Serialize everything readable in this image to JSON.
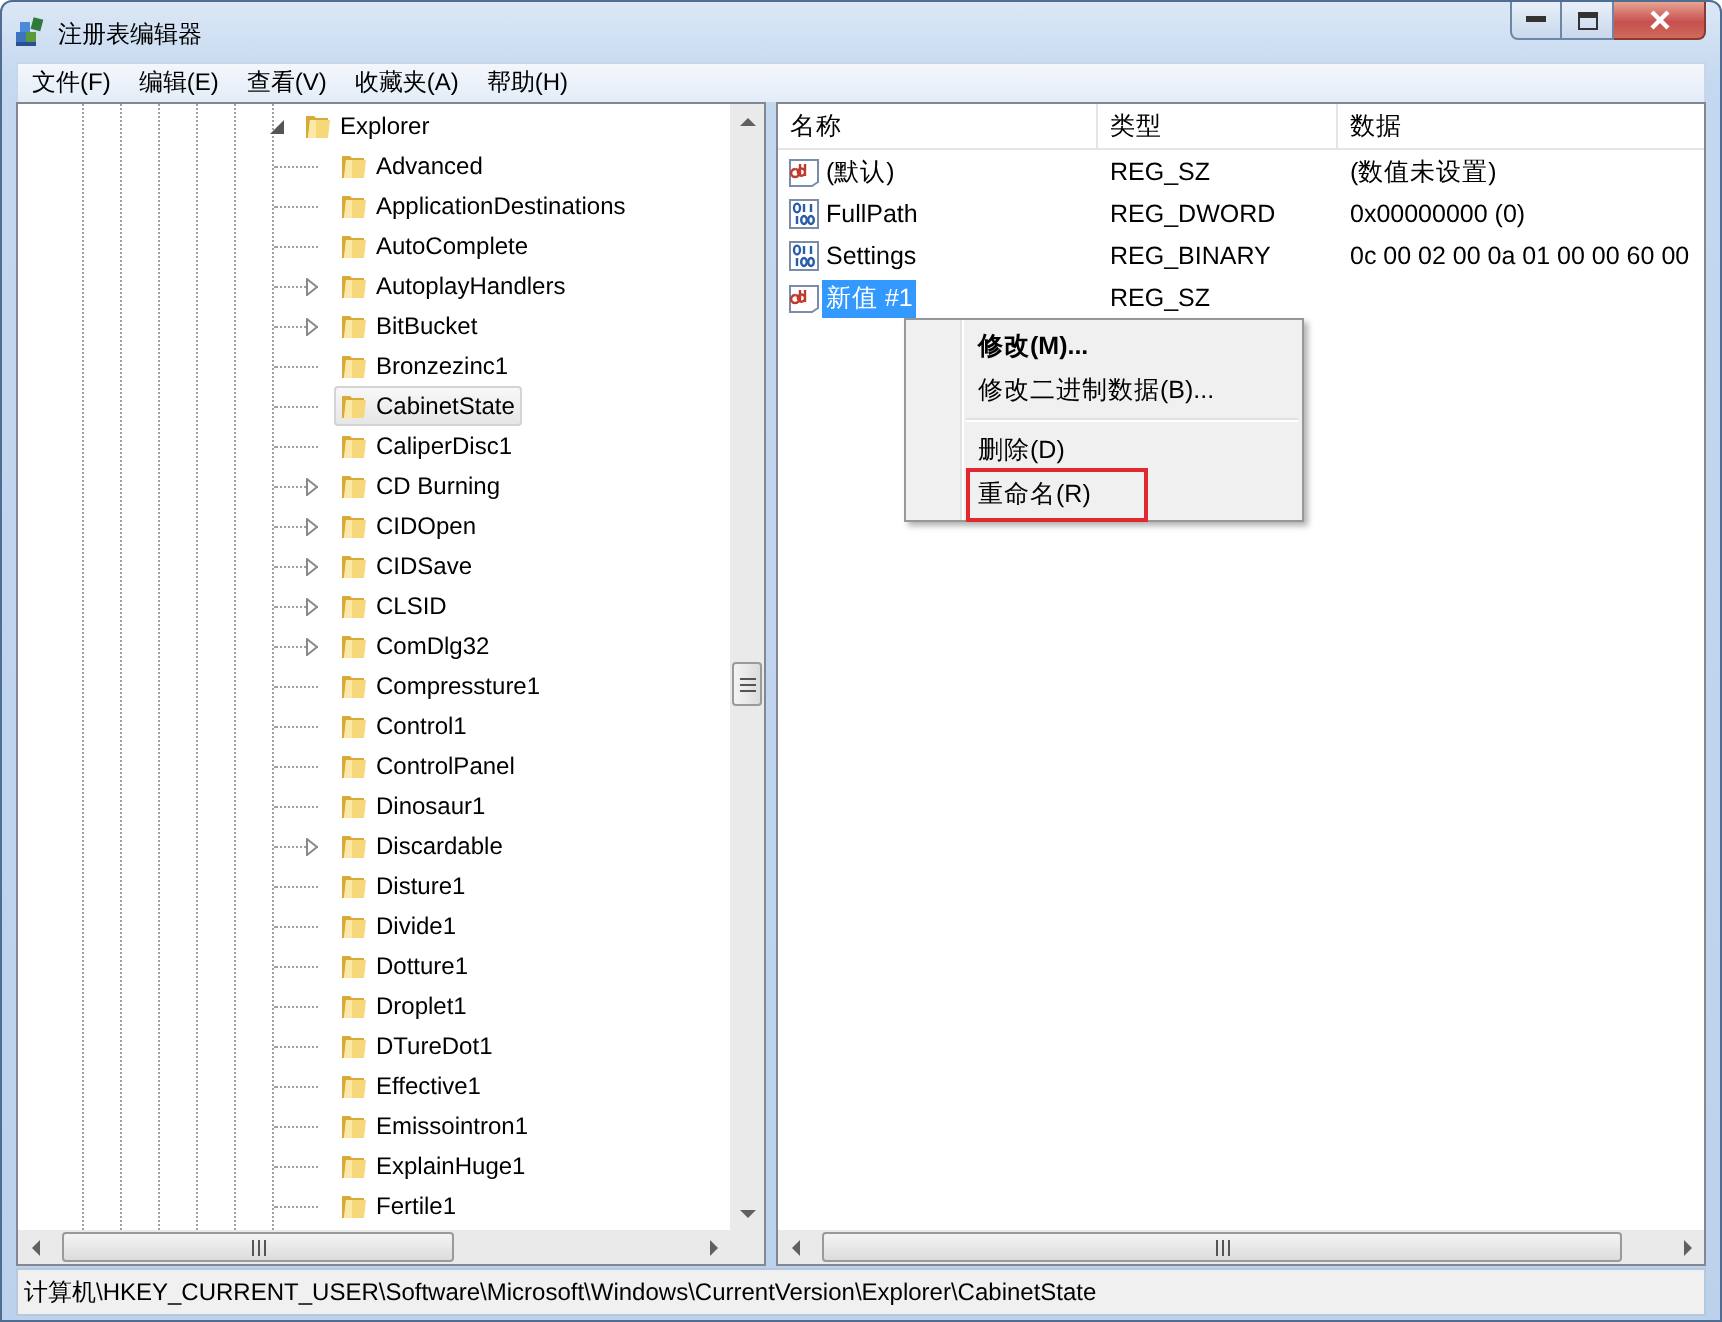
{
  "window": {
    "title": "注册表编辑器"
  },
  "menu": [
    "文件(F)",
    "编辑(E)",
    "查看(V)",
    "收藏夹(A)",
    "帮助(H)"
  ],
  "tree": {
    "label": "Explorer",
    "expanded": true,
    "selected": false,
    "children": [
      {
        "label": "Advanced",
        "expandable": false,
        "selected": false
      },
      {
        "label": "ApplicationDestinations",
        "expandable": false,
        "selected": false
      },
      {
        "label": "AutoComplete",
        "expandable": false,
        "selected": false
      },
      {
        "label": "AutoplayHandlers",
        "expandable": true,
        "selected": false
      },
      {
        "label": "BitBucket",
        "expandable": true,
        "selected": false
      },
      {
        "label": "Bronzezinc1",
        "expandable": false,
        "selected": false
      },
      {
        "label": "CabinetState",
        "expandable": false,
        "selected": true
      },
      {
        "label": "CaliperDisc1",
        "expandable": false,
        "selected": false
      },
      {
        "label": "CD Burning",
        "expandable": true,
        "selected": false
      },
      {
        "label": "CIDOpen",
        "expandable": true,
        "selected": false
      },
      {
        "label": "CIDSave",
        "expandable": true,
        "selected": false
      },
      {
        "label": "CLSID",
        "expandable": true,
        "selected": false
      },
      {
        "label": "ComDlg32",
        "expandable": true,
        "selected": false
      },
      {
        "label": "Compressture1",
        "expandable": false,
        "selected": false
      },
      {
        "label": "Control1",
        "expandable": false,
        "selected": false
      },
      {
        "label": "ControlPanel",
        "expandable": false,
        "selected": false
      },
      {
        "label": "Dinosaur1",
        "expandable": false,
        "selected": false
      },
      {
        "label": "Discardable",
        "expandable": true,
        "selected": false
      },
      {
        "label": "Disture1",
        "expandable": false,
        "selected": false
      },
      {
        "label": "Divide1",
        "expandable": false,
        "selected": false
      },
      {
        "label": "Dotture1",
        "expandable": false,
        "selected": false
      },
      {
        "label": "Droplet1",
        "expandable": false,
        "selected": false
      },
      {
        "label": "DTureDot1",
        "expandable": false,
        "selected": false
      },
      {
        "label": "Effective1",
        "expandable": false,
        "selected": false
      },
      {
        "label": "Emissointron1",
        "expandable": false,
        "selected": false
      },
      {
        "label": "ExplainHuge1",
        "expandable": false,
        "selected": false
      },
      {
        "label": "Fertile1",
        "expandable": false,
        "selected": false
      }
    ]
  },
  "values": {
    "columns": [
      "名称",
      "类型",
      "数据"
    ],
    "rows": [
      {
        "kind": "string",
        "name": "(默认)",
        "type": "REG_SZ",
        "data": "(数值未设置)",
        "selected": false
      },
      {
        "kind": "binary",
        "name": "FullPath",
        "type": "REG_DWORD",
        "data": "0x00000000 (0)",
        "selected": false
      },
      {
        "kind": "binary",
        "name": "Settings",
        "type": "REG_BINARY",
        "data": "0c 00 02 00 0a 01 00 00 60 00",
        "selected": false
      },
      {
        "kind": "string",
        "name": "新值 #1",
        "type": "REG_SZ",
        "selected": true
      }
    ]
  },
  "context_menu": {
    "items": [
      {
        "kind": "item",
        "label": "修改(M)...",
        "default": true,
        "outlined": false
      },
      {
        "kind": "item",
        "label": "修改二进制数据(B)...",
        "default": false,
        "outlined": false
      },
      {
        "kind": "separator"
      },
      {
        "kind": "item",
        "label": "删除(D)",
        "default": false,
        "outlined": false
      },
      {
        "kind": "item",
        "label": "重命名(R)",
        "default": false,
        "outlined": true
      }
    ]
  },
  "status_bar": "计算机\\HKEY_CURRENT_USER\\Software\\Microsoft\\Windows\\CurrentVersion\\Explorer\\CabinetState"
}
